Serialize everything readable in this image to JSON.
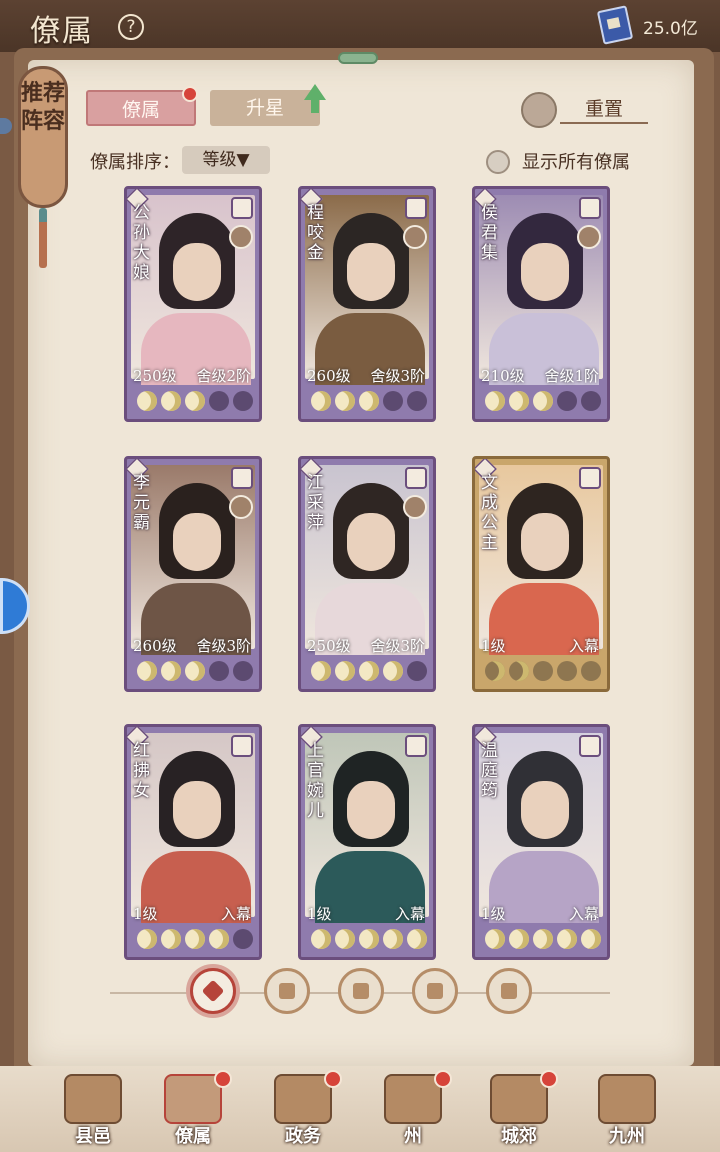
{
  "header": {
    "title": "僚属",
    "help_symbol": "?",
    "currency": "25.0亿"
  },
  "bookmark": {
    "label": "推荐阵容"
  },
  "tabs": [
    {
      "label": "僚属",
      "active": true
    },
    {
      "label": "升星",
      "active": false
    }
  ],
  "reset": {
    "label": "重置"
  },
  "sort": {
    "label": "僚属排序：",
    "value": "等级▼"
  },
  "show_all": {
    "label": "显示所有僚属",
    "checked": false
  },
  "cards": [
    {
      "name": "公孙大娘",
      "level": "250级",
      "stage": "舍级2阶",
      "stars": 3,
      "gold": false
    },
    {
      "name": "程咬金",
      "level": "260级",
      "stage": "舍级3阶",
      "stars": 3,
      "gold": false
    },
    {
      "name": "侯君集",
      "level": "210级",
      "stage": "舍级1阶",
      "stars": 3,
      "gold": false
    },
    {
      "name": "李元霸",
      "level": "260级",
      "stage": "舍级3阶",
      "stars": 3,
      "gold": false
    },
    {
      "name": "江采萍",
      "level": "250级",
      "stage": "舍级3阶",
      "stars": 4,
      "gold": false
    },
    {
      "name": "文成公主",
      "level": "1级",
      "stage": "入幕",
      "stars": 2,
      "gold": true
    },
    {
      "name": "红拂女",
      "level": "1级",
      "stage": "入幕",
      "stars": 4,
      "gold": false
    },
    {
      "name": "上官婉儿",
      "level": "1级",
      "stage": "入幕",
      "stars": 5,
      "gold": false
    },
    {
      "name": "温庭筠",
      "level": "1级",
      "stage": "入幕",
      "stars": 5,
      "gold": false
    }
  ],
  "filters": [
    "all-icon",
    "cat-icon",
    "gourd-icon",
    "fan-icon",
    "lion-icon"
  ],
  "nav": [
    {
      "label": "县邑",
      "badge": false
    },
    {
      "label": "僚属",
      "badge": true
    },
    {
      "label": "政务",
      "badge": true
    },
    {
      "label": "州",
      "badge": true
    },
    {
      "label": "城郊",
      "badge": true
    },
    {
      "label": "九州",
      "badge": false
    }
  ],
  "colors": {
    "accent": "#d9a0a0",
    "card": "#8f7bad",
    "gold_card": "#c9a66b",
    "badge": "#d6443a"
  }
}
